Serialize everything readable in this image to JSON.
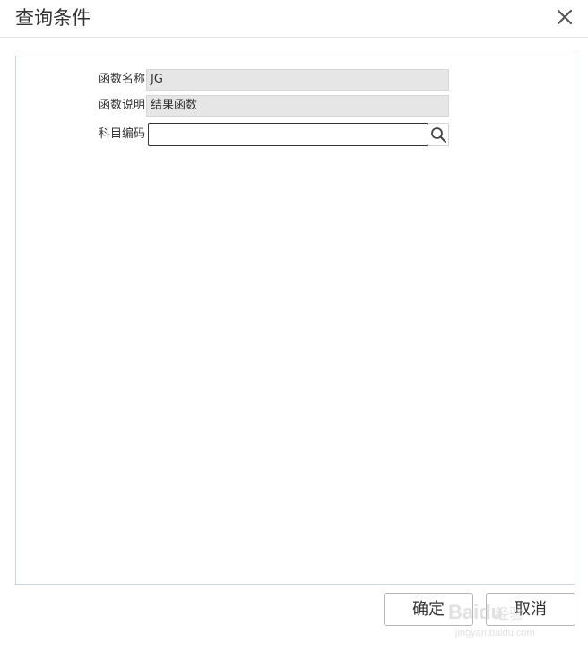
{
  "dialog": {
    "title": "查询条件",
    "close_icon": "close-icon"
  },
  "form": {
    "function_name": {
      "label": "函数名称",
      "value": "JG"
    },
    "function_desc": {
      "label": "函数说明",
      "value": "结果函数"
    },
    "subject_code": {
      "label": "科目编码",
      "value": "",
      "search_icon": "search-icon"
    }
  },
  "footer": {
    "ok_label": "确定",
    "cancel_label": "取消"
  },
  "watermark": {
    "brand": "Baidu",
    "sub": "经验",
    "url": "jingyan.baidu.com"
  }
}
